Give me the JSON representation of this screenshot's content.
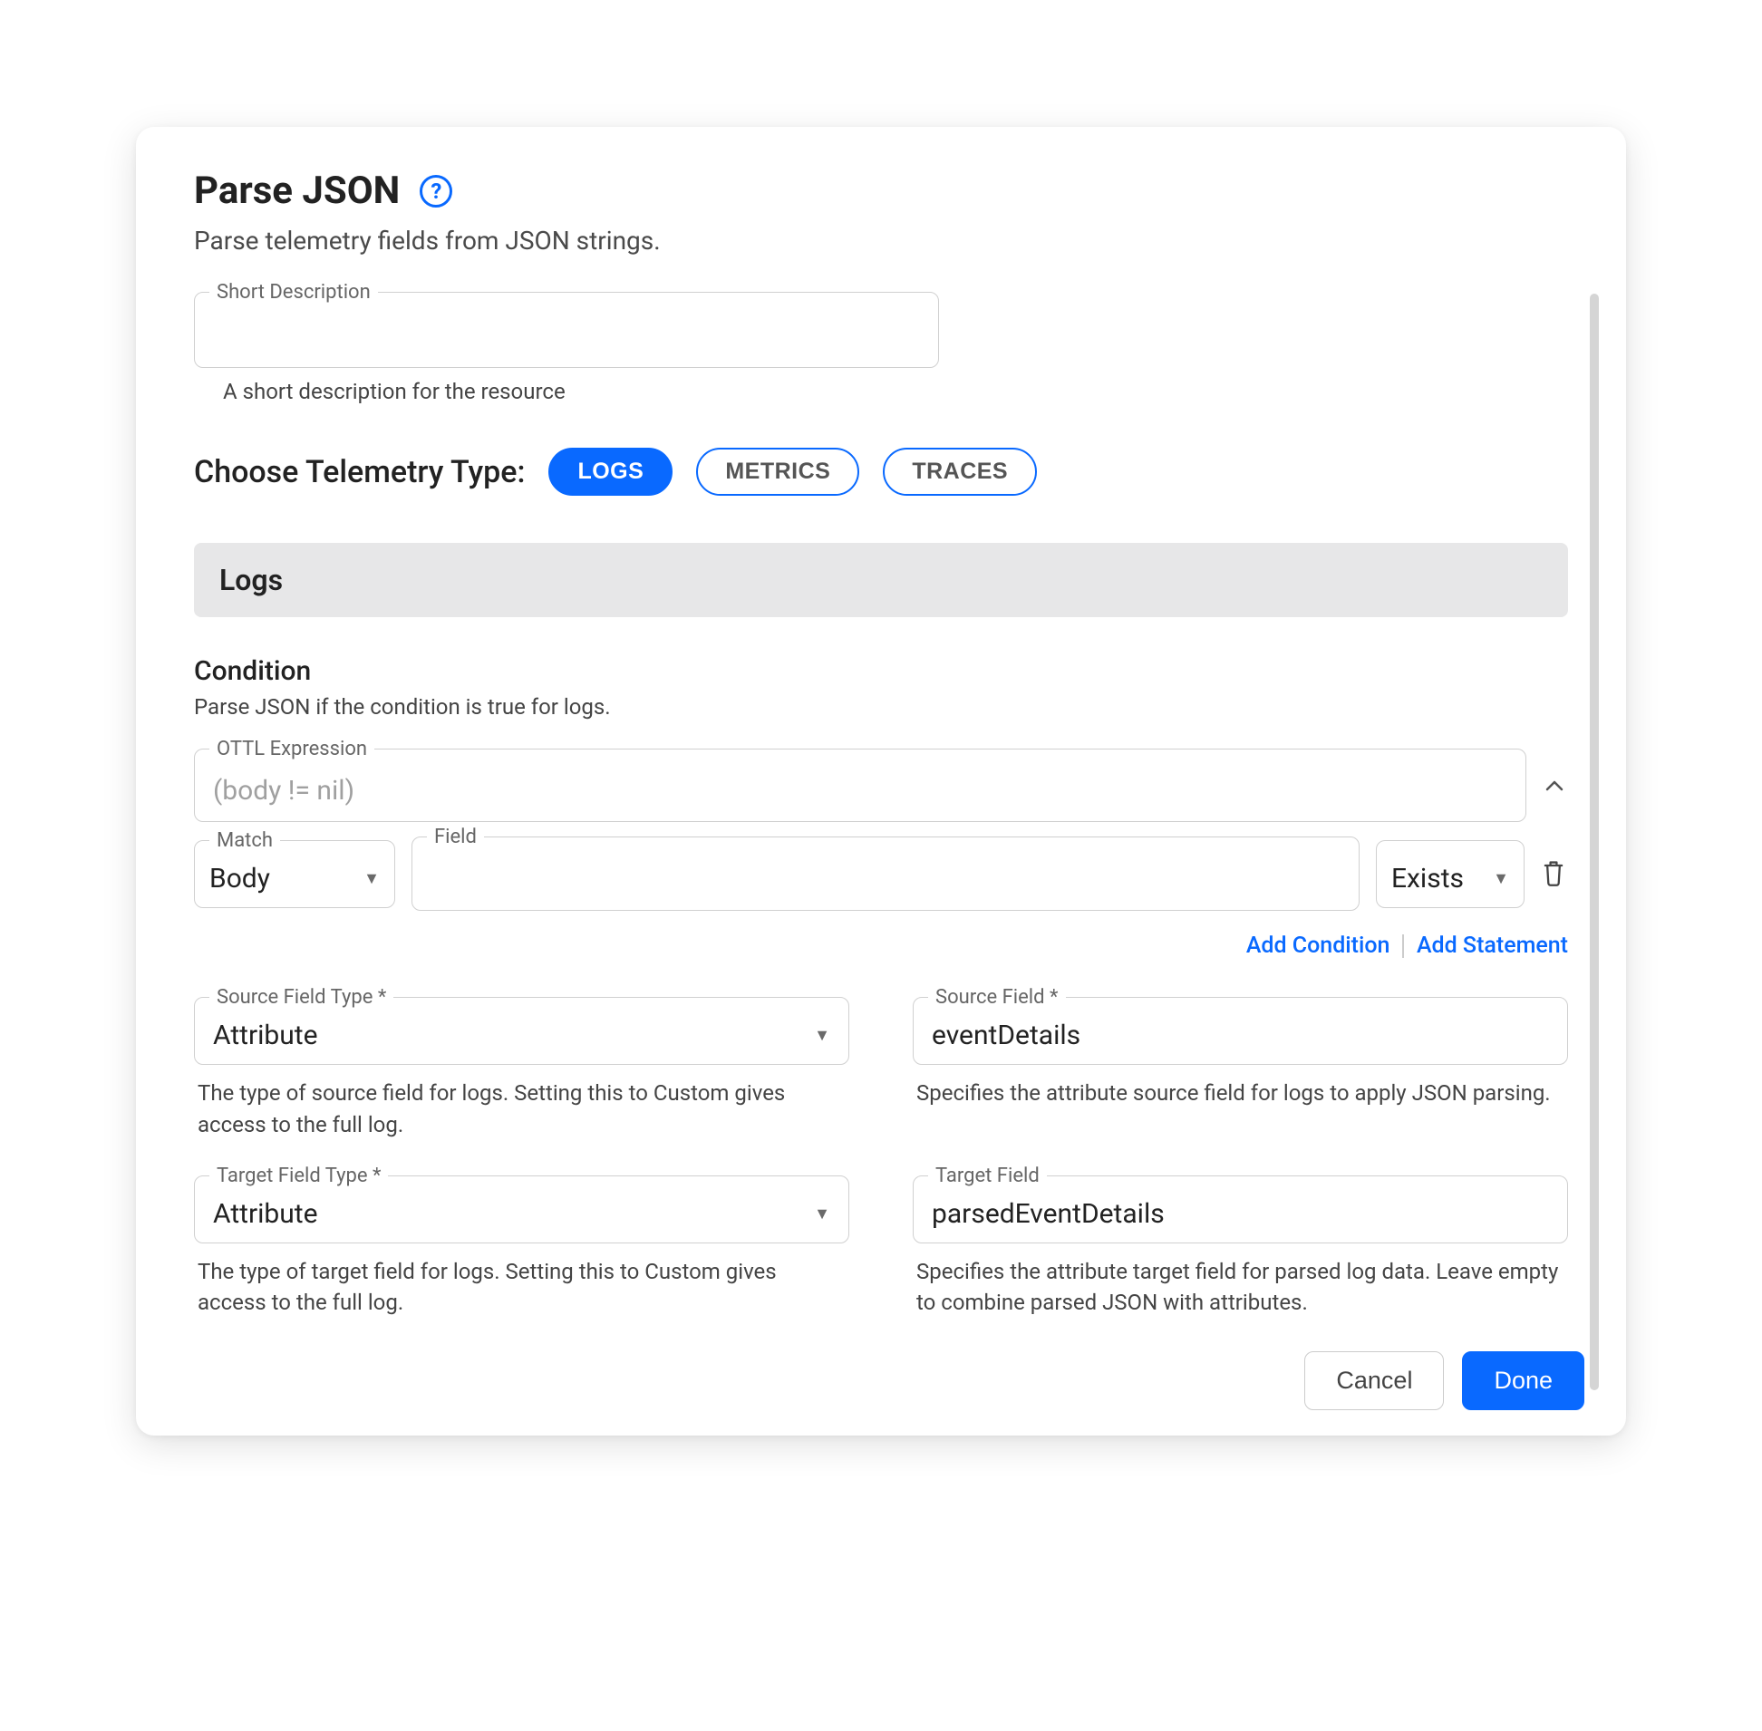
{
  "header": {
    "title": "Parse JSON",
    "subtitle": "Parse telemetry fields from JSON strings."
  },
  "shortDescription": {
    "label": "Short Description",
    "value": "",
    "helper": "A short description for the resource"
  },
  "telemetry": {
    "label": "Choose Telemetry Type:",
    "options": [
      "LOGS",
      "METRICS",
      "TRACES"
    ],
    "selected": "LOGS"
  },
  "banner": "Logs",
  "condition": {
    "title": "Condition",
    "subtitle": "Parse JSON if the condition is true for logs.",
    "ottl": {
      "label": "OTTL Expression",
      "value": "(body != nil)"
    },
    "match": {
      "label": "Match",
      "value": "Body"
    },
    "field": {
      "label": "Field",
      "value": ""
    },
    "operator": {
      "value": "Exists"
    },
    "links": {
      "addCondition": "Add Condition",
      "addStatement": "Add Statement"
    }
  },
  "sourceFieldType": {
    "label": "Source Field Type *",
    "value": "Attribute",
    "helper": "The type of source field for logs. Setting this to Custom gives access to the full log."
  },
  "sourceField": {
    "label": "Source Field *",
    "value": "eventDetails",
    "helper": "Specifies the attribute source field for logs to apply JSON parsing."
  },
  "targetFieldType": {
    "label": "Target Field Type *",
    "value": "Attribute",
    "helper": "The type of target field for logs. Setting this to Custom gives access to the full log."
  },
  "targetField": {
    "label": "Target Field",
    "value": "parsedEventDetails",
    "helper": "Specifies the attribute target field for parsed log data. Leave empty to combine parsed JSON with attributes."
  },
  "footer": {
    "cancel": "Cancel",
    "done": "Done"
  }
}
